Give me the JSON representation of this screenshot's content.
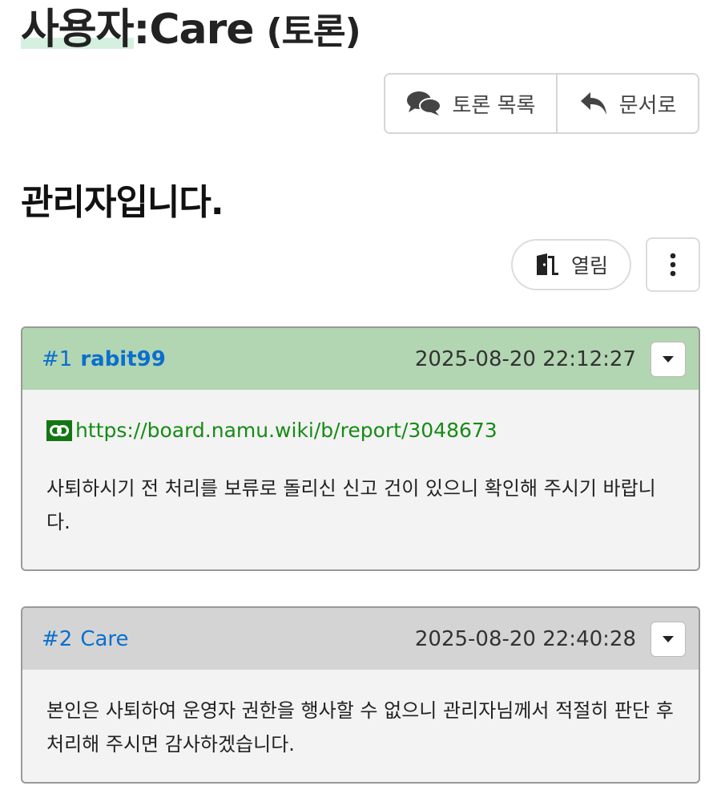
{
  "header": {
    "namespace": "사용자",
    "separator": ":",
    "document": "Care",
    "suffix": "(토론)"
  },
  "toolbar": {
    "discussion_list_label": "토론 목록",
    "to_document_label": "문서로"
  },
  "topic": {
    "title": "관리자입니다.",
    "status_label": "열림"
  },
  "comments": [
    {
      "number": "#1",
      "author": "rabit99",
      "time": "2025-08-20 22:12:27",
      "link": "https://board.namu.wiki/b/report/3048673",
      "text": "사퇴하시기 전 처리를 보류로 돌리신 신고 건이 있으니 확인해 주시기 바랍니다."
    },
    {
      "number": "#2",
      "author": "Care",
      "time": "2025-08-20 22:40:28",
      "text": "본인은 사퇴하여 운영자 권한을 행사할 수 없으니 관리자님께서 적절히 판단 후 처리해 주시면 감사하겠습니다."
    }
  ],
  "colors": {
    "comment1_header": "#b2d5b2",
    "comment2_header": "#d4d4d4",
    "author_link": "#0a6fcf",
    "external_link": "#168b16"
  }
}
